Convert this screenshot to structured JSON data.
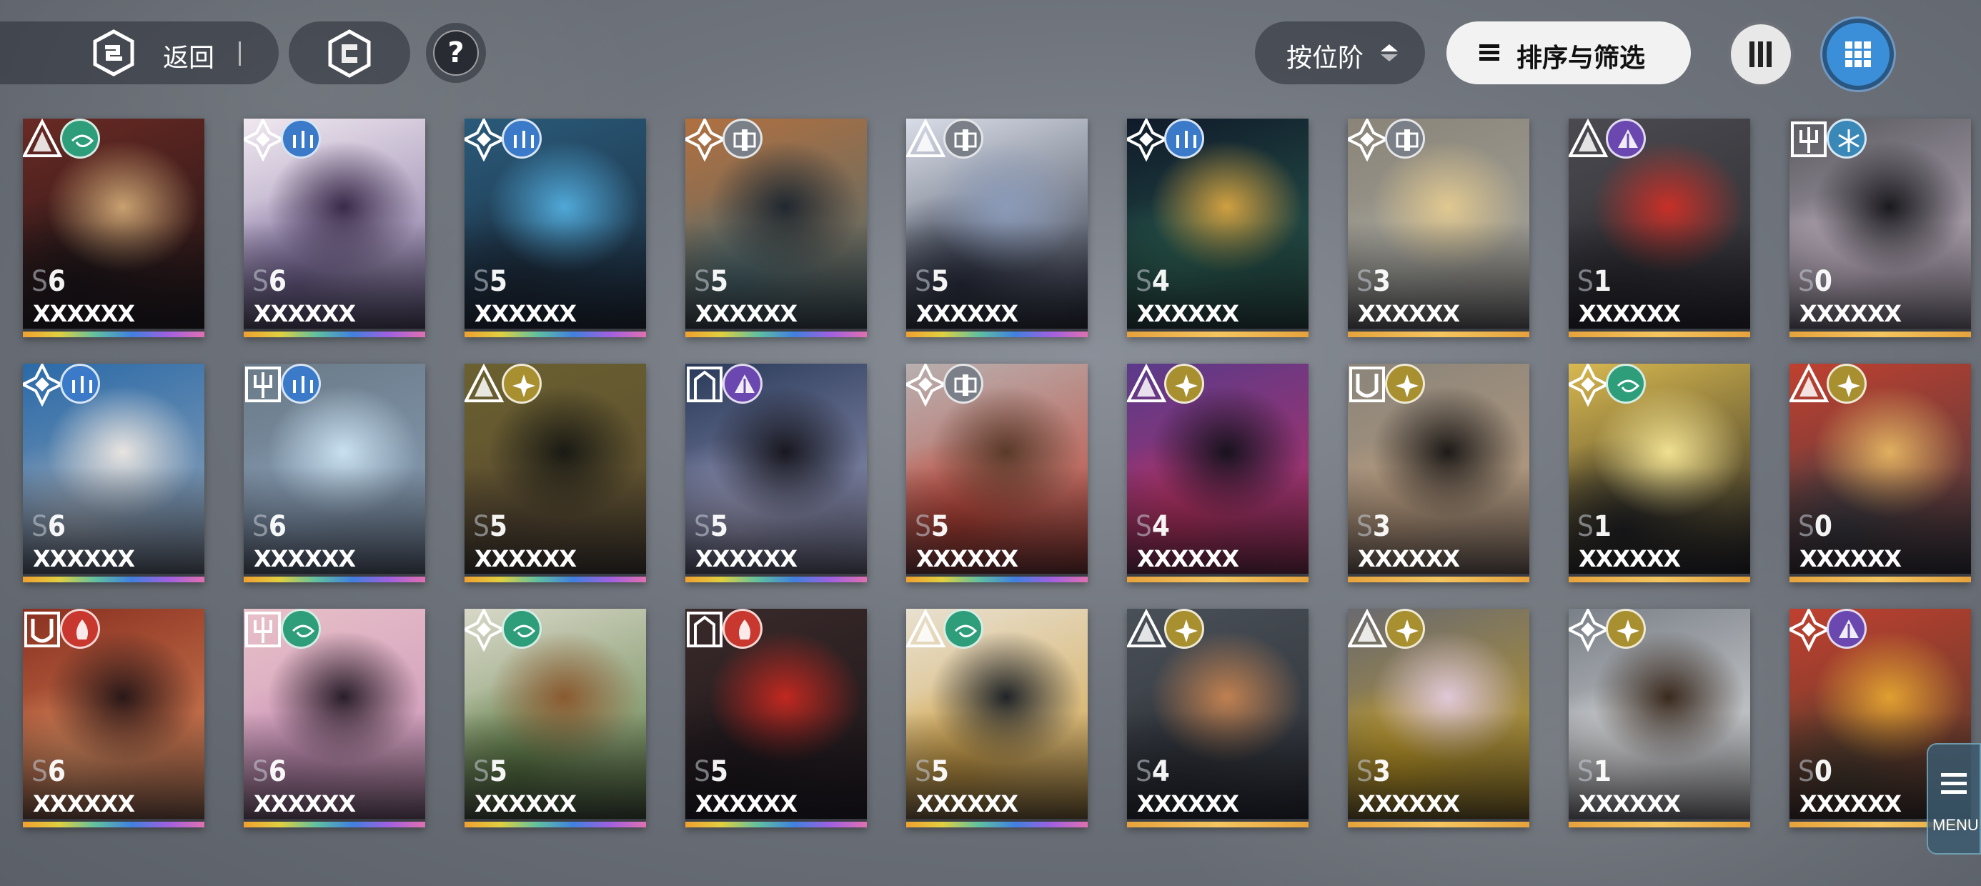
{
  "top_bar": {
    "back_label": "返回",
    "sort_rank_label": "按位阶",
    "sort_filter_label": "排序与筛选",
    "help_glyph": "?",
    "view_active": "grid"
  },
  "menu_label": "MENU",
  "colors": {
    "grid_active": "#3a8fd8",
    "rank_stripe_high": "rainbow",
    "rank_stripe_low": "gold"
  },
  "cards": [
    {
      "rank": "6",
      "name": "XXXXXX",
      "class": "spire",
      "element": "wind",
      "element_color": "#2e9e7a",
      "portrait": [
        "#6a2a24",
        "#c8a070",
        "#1a1214"
      ],
      "stripe": "rainbow"
    },
    {
      "rank": "6",
      "name": "XXXXXX",
      "class": "star",
      "element": "water",
      "element_color": "#3a7ac8",
      "portrait": [
        "#f0e8f0",
        "#3a2a4a",
        "#7a6a9a"
      ],
      "stripe": "rainbow"
    },
    {
      "rank": "5",
      "name": "XXXXXX",
      "class": "star",
      "element": "water",
      "element_color": "#3a7ac8",
      "portrait": [
        "#2a5a7a",
        "#50a8d8",
        "#1a2a3a"
      ],
      "stripe": "rainbow"
    },
    {
      "rank": "5",
      "name": "XXXXXX",
      "class": "star",
      "element": "mech",
      "element_color": "#7a7f88",
      "portrait": [
        "#b07040",
        "#202830",
        "#4a6a70"
      ],
      "stripe": "rainbow"
    },
    {
      "rank": "5",
      "name": "XXXXXX",
      "class": "spire",
      "element": "mech",
      "element_color": "#7a7f88",
      "portrait": [
        "#d8dde8",
        "#8a9ab8",
        "#2a3040"
      ],
      "stripe": "rainbow"
    },
    {
      "rank": "4",
      "name": "XXXXXX",
      "class": "star",
      "element": "water",
      "element_color": "#3a7ac8",
      "portrait": [
        "#101a2a",
        "#d0a040",
        "#2a6050"
      ],
      "stripe": "gold"
    },
    {
      "rank": "3",
      "name": "XXXXXX",
      "class": "star",
      "element": "mech",
      "element_color": "#7a7f88",
      "portrait": [
        "#8a8478",
        "#e0c890",
        "#a8a8a0"
      ],
      "stripe": "gold"
    },
    {
      "rank": "1",
      "name": "XXXXXX",
      "class": "spire",
      "element": "arcane",
      "element_color": "#6a48b0",
      "portrait": [
        "#4a4a50",
        "#c83028",
        "#2a2a2e"
      ],
      "stripe": "gold"
    },
    {
      "rank": "0",
      "name": "XXXXXX",
      "class": "trident",
      "element": "ice",
      "element_color": "#3a88b8",
      "portrait": [
        "#5a5a60",
        "#1a1a1e",
        "#d0c0d0"
      ],
      "stripe": "gold"
    },
    {
      "rank": "6",
      "name": "XXXXXX",
      "class": "star",
      "element": "water",
      "element_color": "#3a7ac8",
      "portrait": [
        "#2a6aa8",
        "#e8e4e0",
        "#9aa8b8"
      ],
      "stripe": "rainbow"
    },
    {
      "rank": "6",
      "name": "XXXXXX",
      "class": "trident",
      "element": "water",
      "element_color": "#3a7ac8",
      "portrait": [
        "#6a7a88",
        "#c8e0f0",
        "#8aa0b8"
      ],
      "stripe": "rainbow"
    },
    {
      "rank": "5",
      "name": "XXXXXX",
      "class": "spire",
      "element": "light",
      "element_color": "#a89030",
      "portrait": [
        "#6a6030",
        "#1a1a14",
        "#5a4a30"
      ],
      "stripe": "rainbow"
    },
    {
      "rank": "5",
      "name": "XXXXXX",
      "class": "gate",
      "element": "arcane",
      "element_color": "#6a48b0",
      "portrait": [
        "#2a3a5a",
        "#181820",
        "#a0a0c0"
      ],
      "stripe": "rainbow"
    },
    {
      "rank": "5",
      "name": "XXXXXX",
      "class": "star",
      "element": "mech",
      "element_color": "#7a7f88",
      "portrait": [
        "#b8b0b0",
        "#5a3a2a",
        "#c04030"
      ],
      "stripe": "rainbow"
    },
    {
      "rank": "4",
      "name": "XXXXXX",
      "class": "spire",
      "element": "light",
      "element_color": "#a89030",
      "portrait": [
        "#5a3a8a",
        "#18121e",
        "#c03060"
      ],
      "stripe": "gold"
    },
    {
      "rank": "3",
      "name": "XXXXXX",
      "class": "shield",
      "element": "light",
      "element_color": "#a89030",
      "portrait": [
        "#8a847a",
        "#1e1a18",
        "#c0a080"
      ],
      "stripe": "gold"
    },
    {
      "rank": "1",
      "name": "XXXXXX",
      "class": "star",
      "element": "wind",
      "element_color": "#2e9e7a",
      "portrait": [
        "#d8b850",
        "#f0e090",
        "#202020"
      ],
      "stripe": "gold"
    },
    {
      "rank": "0",
      "name": "XXXXXX",
      "class": "spire",
      "element": "light",
      "element_color": "#a89030",
      "portrait": [
        "#c04030",
        "#e0b060",
        "#3a3a40"
      ],
      "stripe": "gold"
    },
    {
      "rank": "6",
      "name": "XXXXXX",
      "class": "shield",
      "element": "fire",
      "element_color": "#c8382e",
      "portrait": [
        "#8a3020",
        "#2a1818",
        "#e09060"
      ],
      "stripe": "rainbow"
    },
    {
      "rank": "6",
      "name": "XXXXXX",
      "class": "trident",
      "element": "wind",
      "element_color": "#2e9e7a",
      "portrait": [
        "#e8c0c8",
        "#2a1e2a",
        "#c890b8"
      ],
      "stripe": "rainbow"
    },
    {
      "rank": "5",
      "name": "XXXXXX",
      "class": "star",
      "element": "wind",
      "element_color": "#2e9e7a",
      "portrait": [
        "#d8d8c8",
        "#8a5a30",
        "#5a7a40"
      ],
      "stripe": "rainbow"
    },
    {
      "rank": "5",
      "name": "XXXXXX",
      "class": "gate",
      "element": "fire",
      "element_color": "#c8382e",
      "portrait": [
        "#3a2a2a",
        "#c02820",
        "#1a1418"
      ],
      "stripe": "rainbow"
    },
    {
      "rank": "5",
      "name": "XXXXXX",
      "class": "spire",
      "element": "wind",
      "element_color": "#2e9e7a",
      "portrait": [
        "#e8e0d0",
        "#202428",
        "#d0a040"
      ],
      "stripe": "rainbow"
    },
    {
      "rank": "4",
      "name": "XXXXXX",
      "class": "spire",
      "element": "light",
      "element_color": "#a89030",
      "portrait": [
        "#4a5058",
        "#c08050",
        "#2a2e34"
      ],
      "stripe": "gold"
    },
    {
      "rank": "3",
      "name": "XXXXXX",
      "class": "spire",
      "element": "light",
      "element_color": "#a89030",
      "portrait": [
        "#6a6a70",
        "#e0c8d8",
        "#c8a020"
      ],
      "stripe": "gold"
    },
    {
      "rank": "1",
      "name": "XXXXXX",
      "class": "star",
      "element": "light",
      "element_color": "#a89030",
      "portrait": [
        "#7a8088",
        "#3a2a1e",
        "#e8e8e8"
      ],
      "stripe": "gold"
    },
    {
      "rank": "0",
      "name": "XXXXXX",
      "class": "star",
      "element": "arcane",
      "element_color": "#6a48b0",
      "portrait": [
        "#c04030",
        "#e0a030",
        "#4a3a2a"
      ],
      "stripe": "gold"
    }
  ]
}
